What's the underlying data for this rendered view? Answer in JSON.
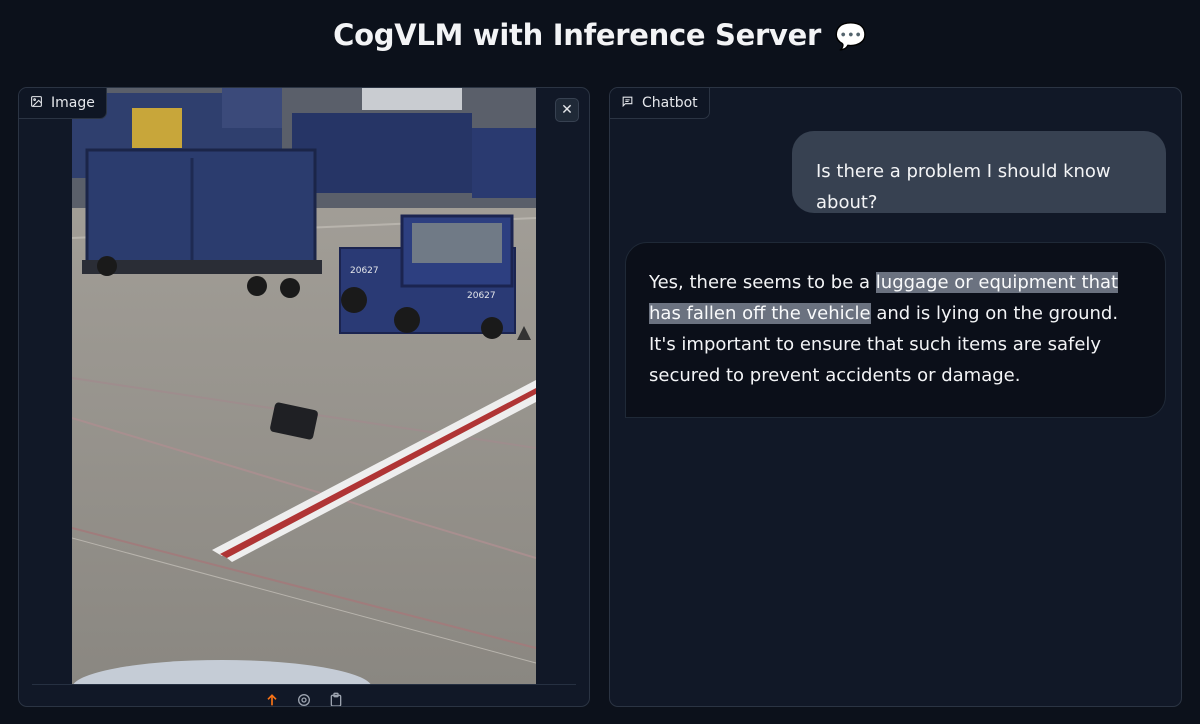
{
  "app": {
    "title": "CogVLM with Inference Server",
    "title_emoji": "💬"
  },
  "image_panel": {
    "label": "Image",
    "icon": "image-icon",
    "clear_icon": "close-icon",
    "toolbar_icons": [
      "upload-icon",
      "webcam-icon",
      "clipboard-icon"
    ]
  },
  "chatbot_panel": {
    "label": "Chatbot",
    "icon": "chat-icon",
    "messages": [
      {
        "role": "user",
        "text": "Is there a problem I should know about?"
      },
      {
        "role": "bot",
        "text_pre": "Yes, there seems to be a ",
        "text_highlight": "luggage or equipment that has fallen off the vehicle",
        "text_post": " and is lying on the ground. It's important to ensure that such items are safely secured to prevent accidents or damage."
      }
    ]
  },
  "photo": {
    "vehicle_number": "20627"
  },
  "colors": {
    "background": "#0c111b",
    "panel": "#111827",
    "user_bubble": "#374151",
    "bot_bubble": "#0b0f19",
    "highlight": "#6b7280",
    "upload_accent": "#f97316"
  }
}
